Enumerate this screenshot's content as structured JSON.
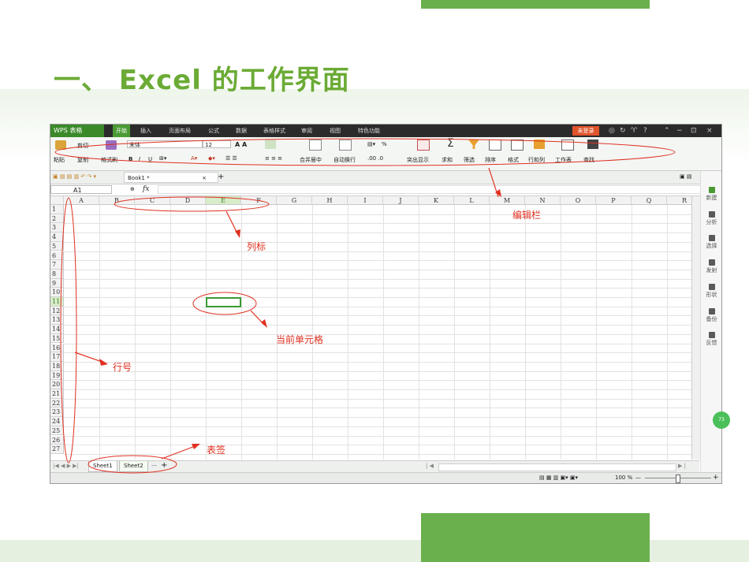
{
  "slide": {
    "title": "一、 Excel 的工作界面"
  },
  "app": {
    "logo": "WPS 表格",
    "menu": [
      "开始",
      "插入",
      "页面布局",
      "公式",
      "数据",
      "表格样式",
      "审阅",
      "视图",
      "特色功能"
    ],
    "login": "未登录",
    "window_controls": [
      "?",
      "−",
      "⊡",
      "×"
    ],
    "ribbon": {
      "paste": "粘贴",
      "cut": "剪切",
      "copy": "复制",
      "format_painter": "格式刷",
      "font_name": "宋体",
      "font_size": "12",
      "bold": "B",
      "italic": "I",
      "underline": "U",
      "merge_center": "合并居中",
      "auto_wrap": "自动换行",
      "percent": "%",
      "highlight": "突出显示",
      "sum": "求和",
      "filter": "筛选",
      "sort": "排序",
      "format": "格式",
      "row_col": "行和列",
      "worksheet": "工作表",
      "find": "查找"
    },
    "doc_tab": "Book1 *",
    "name_box": "A1",
    "fx": "fx",
    "columns": [
      "A",
      "B",
      "C",
      "D",
      "E",
      "F",
      "G",
      "H",
      "I",
      "J",
      "K",
      "L",
      "M",
      "N",
      "O",
      "P",
      "Q",
      "R"
    ],
    "rows": [
      "1",
      "2",
      "3",
      "4",
      "5",
      "6",
      "7",
      "8",
      "9",
      "10",
      "11",
      "12",
      "13",
      "14",
      "15",
      "16",
      "17",
      "18",
      "19",
      "20",
      "21",
      "22",
      "23",
      "24",
      "25",
      "26",
      "27"
    ],
    "selected_column": "E",
    "selected_row": "11",
    "sheets": [
      "Sheet1",
      "Sheet2"
    ],
    "sheet_more": "···",
    "add_sheet": "+",
    "zoom": "100 %",
    "sidebar": [
      "新建",
      "分析",
      "选择",
      "发射",
      "形状",
      "备份",
      "反馈"
    ],
    "float_badge": "73"
  },
  "annotations": {
    "edit_bar": "编辑栏",
    "column_header": "列标",
    "current_cell": "当前单元格",
    "row_number": "行号",
    "sheet_tab": "表签"
  },
  "colors": {
    "accent": "#6ab04c",
    "title": "#6bab35",
    "annotation": "#e03020",
    "selection": "#3a9a34"
  }
}
